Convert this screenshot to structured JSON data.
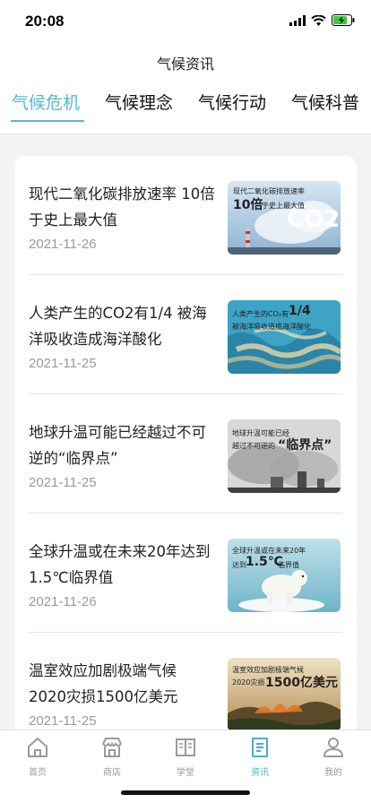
{
  "status": {
    "time": "20:08"
  },
  "header": {
    "title": "气候资讯"
  },
  "tabs": [
    {
      "label": "气候危机"
    },
    {
      "label": "气候理念"
    },
    {
      "label": "气候行动"
    },
    {
      "label": "气候科普"
    }
  ],
  "articles": [
    {
      "title": "现代二氧化碳排放速率 10倍于史上最大值",
      "date": "2021-11-26",
      "thumb_line1": "现代二氧化碳排放速率",
      "thumb_big": "10倍",
      "thumb_line2": "于史上最大值",
      "thumb_formula": "CO2"
    },
    {
      "title": "人类产生的CO2有1/4 被海洋吸收造成海洋酸化",
      "date": "2021-11-25",
      "thumb_line1": "人类产生的CO₂有",
      "thumb_big": "1/4",
      "thumb_line2": "被海洋吸收造成海洋酸化"
    },
    {
      "title": "地球升温可能已经越过不可逆的“临界点”",
      "date": "2021-11-25",
      "thumb_line1": "地球升温可能已经",
      "thumb_line2": "越过不可逆的",
      "thumb_big": "“临界点”"
    },
    {
      "title": "全球升温或在未来20年达到1.5℃临界值",
      "date": "2021-11-26",
      "thumb_line1": "全球升温或在未来20年",
      "thumb_line2": "达到",
      "thumb_big": "1.5℃",
      "thumb_line3": "临界值"
    },
    {
      "title": "温室效应加剧极端气候 2020灾损1500亿美元",
      "date": "2021-11-25",
      "thumb_line1": "温室效应加剧极端气候",
      "thumb_line2": "2020灾损",
      "thumb_big": "1500亿美元"
    }
  ],
  "tabbar": [
    {
      "label": "首页",
      "icon": "home-icon"
    },
    {
      "label": "商店",
      "icon": "shop-icon"
    },
    {
      "label": "学堂",
      "icon": "book-icon"
    },
    {
      "label": "资讯",
      "icon": "news-icon"
    },
    {
      "label": "我的",
      "icon": "profile-icon"
    }
  ],
  "colors": {
    "accent": "#5ab7cc",
    "tab_active": "#4aaecd",
    "date": "#9a9a9a",
    "background": "#f3f3f3"
  }
}
